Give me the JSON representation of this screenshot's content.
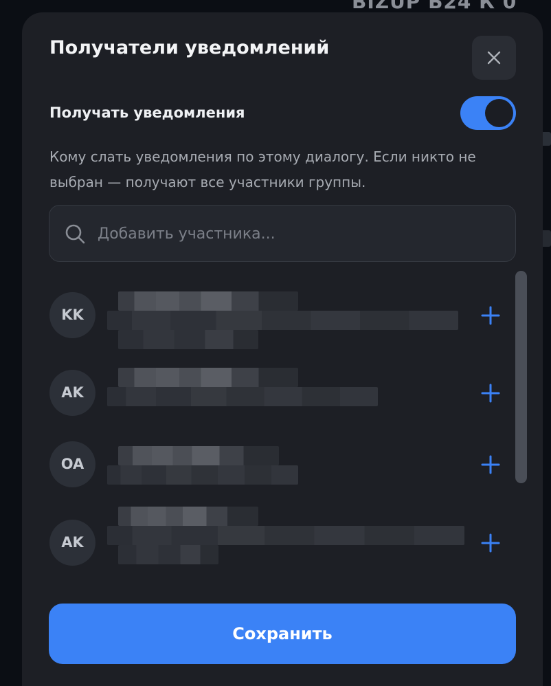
{
  "background": {
    "header_text": "BIZUP Б24 К 0"
  },
  "modal": {
    "title": "Получатели уведомлений",
    "close_icon": "close-icon",
    "toggle": {
      "label": "Получать уведомления",
      "on": true,
      "color": "#3b82f6"
    },
    "description": "Кому слать уведомления по этому диалогу. Если никто не выбран — получают все участники группы.",
    "search": {
      "placeholder": "Добавить участника...",
      "value": "",
      "icon": "search-icon"
    },
    "participants": [
      {
        "initials": "KK"
      },
      {
        "initials": "AK"
      },
      {
        "initials": "OA"
      },
      {
        "initials": "AK"
      }
    ],
    "add_icon": "plus-icon",
    "save_label": "Сохранить",
    "accent_color": "#3b82f6"
  }
}
